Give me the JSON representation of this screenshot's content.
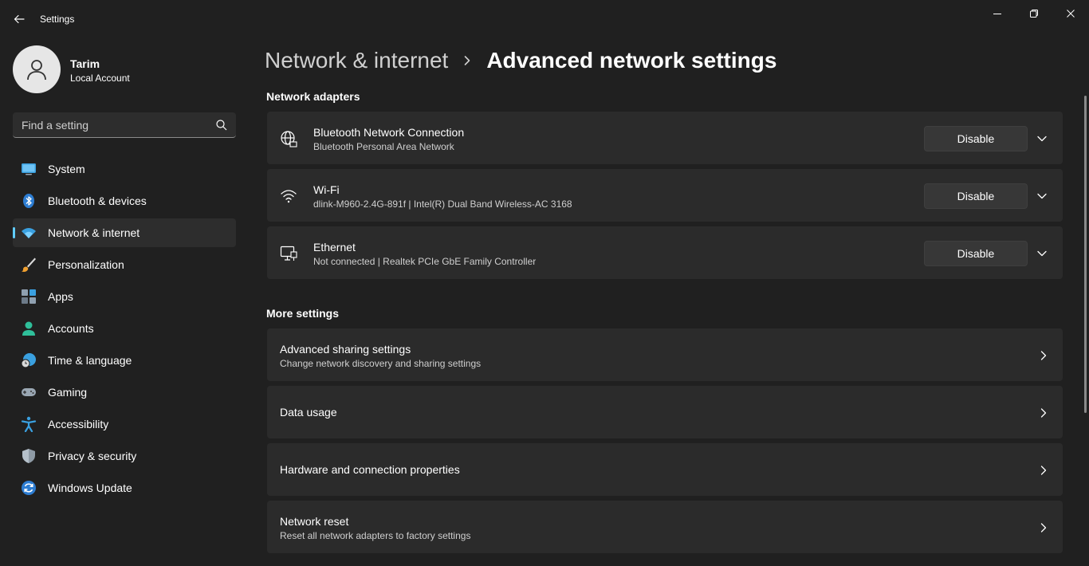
{
  "window": {
    "title": "Settings",
    "controls": [
      "minimize",
      "maximize",
      "close"
    ]
  },
  "profile": {
    "name": "Tarim",
    "account_type": "Local Account"
  },
  "search": {
    "placeholder": "Find a setting"
  },
  "sidebar": {
    "items": [
      {
        "label": "System",
        "icon": "monitor-icon"
      },
      {
        "label": "Bluetooth & devices",
        "icon": "bluetooth-icon"
      },
      {
        "label": "Network & internet",
        "icon": "wifi-icon",
        "active": true
      },
      {
        "label": "Personalization",
        "icon": "brush-icon"
      },
      {
        "label": "Apps",
        "icon": "apps-icon"
      },
      {
        "label": "Accounts",
        "icon": "person-icon"
      },
      {
        "label": "Time & language",
        "icon": "globe-clock-icon"
      },
      {
        "label": "Gaming",
        "icon": "gamepad-icon"
      },
      {
        "label": "Accessibility",
        "icon": "accessibility-icon"
      },
      {
        "label": "Privacy & security",
        "icon": "shield-icon"
      },
      {
        "label": "Windows Update",
        "icon": "update-icon"
      }
    ]
  },
  "breadcrumb": {
    "parent": "Network & internet",
    "current": "Advanced network settings"
  },
  "network_adapters": {
    "title": "Network adapters",
    "adapters": [
      {
        "name": "Bluetooth Network Connection",
        "detail": "Bluetooth Personal Area Network",
        "button": "Disable",
        "icon": "globe-network-icon"
      },
      {
        "name": "Wi-Fi",
        "detail": "dlink-M960-2.4G-891f | Intel(R) Dual Band Wireless-AC 3168",
        "button": "Disable",
        "icon": "wifi-icon"
      },
      {
        "name": "Ethernet",
        "detail": "Not connected | Realtek PCIe GbE Family Controller",
        "button": "Disable",
        "icon": "ethernet-icon"
      }
    ]
  },
  "more_settings": {
    "title": "More settings",
    "items": [
      {
        "title": "Advanced sharing settings",
        "subtitle": "Change network discovery and sharing settings"
      },
      {
        "title": "Data usage"
      },
      {
        "title": "Hardware and connection properties"
      },
      {
        "title": "Network reset",
        "subtitle": "Reset all network adapters to factory settings"
      }
    ]
  },
  "colors": {
    "background": "#202020",
    "card": "#2b2b2b",
    "accent": "#60cdff"
  }
}
